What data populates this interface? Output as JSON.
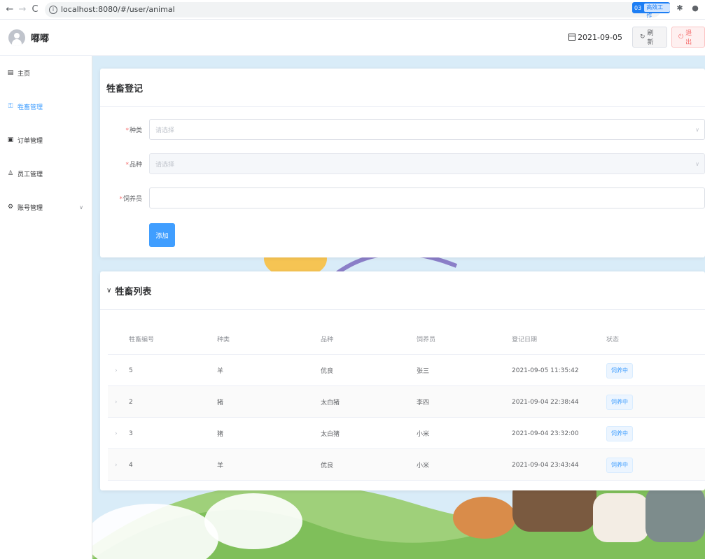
{
  "browser": {
    "url": "localhost:8080/#/user/animal",
    "back_icon": "arrow-left",
    "forward_icon": "arrow-right",
    "reload_icon": "reload",
    "ext_badge": "03",
    "ext_label": "高效工作"
  },
  "header": {
    "username": "嘟嘟",
    "date": "2021-09-05",
    "refresh_label": "刷新",
    "logout_label": "退出"
  },
  "sidebar": {
    "items": [
      {
        "label": "主页",
        "icon": "document-icon",
        "active": false
      },
      {
        "label": "牲畜管理",
        "icon": "lock-icon",
        "active": true
      },
      {
        "label": "订单管理",
        "icon": "gift-icon",
        "active": false
      },
      {
        "label": "员工管理",
        "icon": "user-icon",
        "active": false
      },
      {
        "label": "账号管理",
        "icon": "setting-icon",
        "active": false,
        "has_submenu": true
      }
    ]
  },
  "form_card": {
    "title": "牲畜登记",
    "type_label": "种类",
    "type_placeholder": "请选择",
    "breed_label": "品种",
    "breed_placeholder": "请选择",
    "keeper_label": "饲养员",
    "keeper_value": "",
    "add_label": "添加"
  },
  "list_card": {
    "title": "牲畜列表",
    "columns": [
      "牲畜编号",
      "种类",
      "品种",
      "饲养员",
      "登记日期",
      "状态"
    ],
    "rows": [
      {
        "id": "5",
        "type": "羊",
        "breed": "优良",
        "keeper": "张三",
        "date": "2021-09-05 11:35:42",
        "status": "饲养中"
      },
      {
        "id": "2",
        "type": "猪",
        "breed": "太白猪",
        "keeper": "李四",
        "date": "2021-09-04 22:38:44",
        "status": "饲养中"
      },
      {
        "id": "3",
        "type": "猪",
        "breed": "太白猪",
        "keeper": "小米",
        "date": "2021-09-04 23:32:00",
        "status": "饲养中"
      },
      {
        "id": "4",
        "type": "羊",
        "breed": "优良",
        "keeper": "小米",
        "date": "2021-09-04 23:43:44",
        "status": "饲养中"
      }
    ]
  },
  "colors": {
    "primary": "#409eff",
    "danger": "#f56c6c",
    "tag_bg": "#ecf5ff"
  }
}
